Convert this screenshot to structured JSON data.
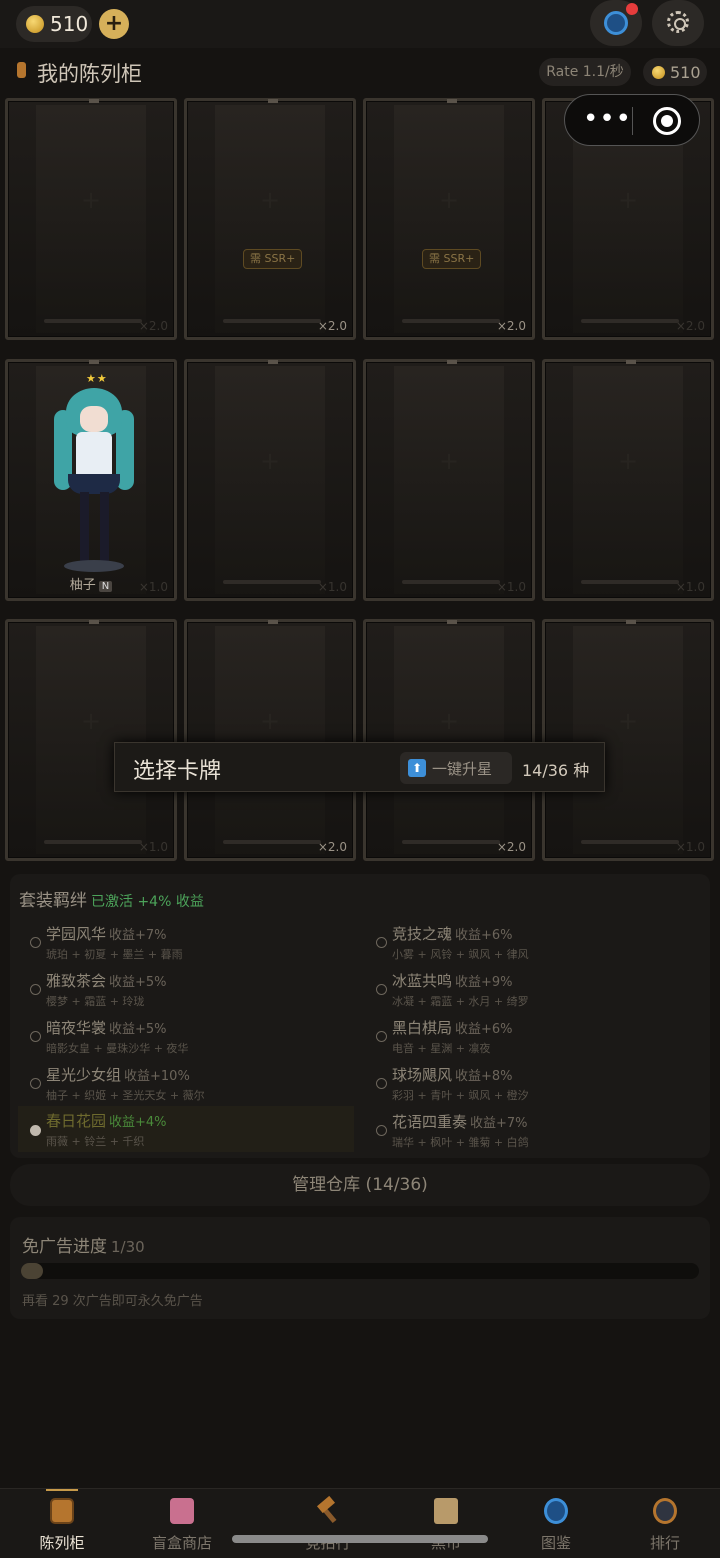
{
  "top": {
    "coins": "510",
    "plus_label": "+",
    "globe_icon": "globe-icon",
    "settings_icon": "gear-icon"
  },
  "header": {
    "title": "我的陈列柜",
    "rate": "Rate 1.1/秒",
    "gold": "510"
  },
  "shelf": {
    "row1": [
      {
        "plus": "+",
        "mult": "×2.0"
      },
      {
        "plus": "+",
        "req": "需 SSR+",
        "mult": "×2.0"
      },
      {
        "plus": "+",
        "req": "需 SSR+",
        "mult": "×2.0"
      },
      {
        "plus": "+",
        "mult": "×2.0"
      }
    ],
    "row2": [
      {
        "name": "柚子",
        "rarity": "N",
        "stars": "★★",
        "mult": "×1.0"
      },
      {
        "plus": "+",
        "mult": "×1.0"
      },
      {
        "plus": "+",
        "mult": "×1.0"
      },
      {
        "plus": "+",
        "mult": "×1.0"
      }
    ],
    "row3": [
      {
        "plus": "+",
        "mult": "×1.0"
      },
      {
        "plus": "+",
        "mult": "×2.0"
      },
      {
        "plus": "+",
        "mult": "×2.0"
      },
      {
        "plus": "+",
        "mult": "×1.0"
      }
    ]
  },
  "select": {
    "title": "选择卡牌",
    "upgrade_icon": "arrow-up-icon",
    "upgrade_label": "一键升星",
    "count": "14/36 种"
  },
  "sets": {
    "title": "套装羁绊",
    "active_label": "已激活 +4% 收益",
    "items": [
      {
        "name": "学园风华",
        "bonus": "收益+7%",
        "members": "琥珀 + 初夏 + 墨兰 + 暮雨"
      },
      {
        "name": "竞技之魂",
        "bonus": "收益+6%",
        "members": "小雾 + 风铃 + 飒风 + 律风"
      },
      {
        "name": "雅致茶会",
        "bonus": "收益+5%",
        "members": "樱梦 + 霜蓝 + 玲珑"
      },
      {
        "name": "冰蓝共鸣",
        "bonus": "收益+9%",
        "members": "冰凝 + 霜蓝 + 水月 + 绮罗"
      },
      {
        "name": "暗夜华裳",
        "bonus": "收益+5%",
        "members": "暗影女皇 + 曼珠沙华 + 夜华"
      },
      {
        "name": "黑白棋局",
        "bonus": "收益+6%",
        "members": "电音 + 星渊 + 凛夜"
      },
      {
        "name": "星光少女组",
        "bonus": "收益+10%",
        "members": "柚子 + 织姬 + 圣光天女 + 薇尔"
      },
      {
        "name": "球场飓风",
        "bonus": "收益+8%",
        "members": "彩羽 + 青叶 + 飒风 + 橙汐"
      },
      {
        "name": "春日花园",
        "bonus": "收益+4%",
        "members": "雨薇 + 铃兰 + 千织",
        "active": true
      },
      {
        "name": "花语四重奏",
        "bonus": "收益+7%",
        "members": "瑞华 + 枫叶 + 雏菊 + 白鸽"
      }
    ]
  },
  "manage": {
    "label": "管理仓库 (14/36)"
  },
  "ad": {
    "title": "免广告进度",
    "count": "1/30",
    "progress": 0.033,
    "hint": "再看 29 次广告即可永久免广告"
  },
  "nav": {
    "tabs": [
      {
        "label": "陈列柜",
        "icon": "lantern-icon",
        "active": true
      },
      {
        "label": "盲盒商店",
        "icon": "gift-box-icon"
      },
      {
        "label": "竞拍行",
        "icon": "hammer-icon"
      },
      {
        "label": "黑市",
        "icon": "scroll-icon"
      },
      {
        "label": "图鉴",
        "icon": "globe-icon"
      },
      {
        "label": "排行",
        "icon": "magnifier-icon"
      }
    ]
  },
  "capsule": {
    "more_icon": "more-dots-icon",
    "close_icon": "target-circle-icon"
  }
}
